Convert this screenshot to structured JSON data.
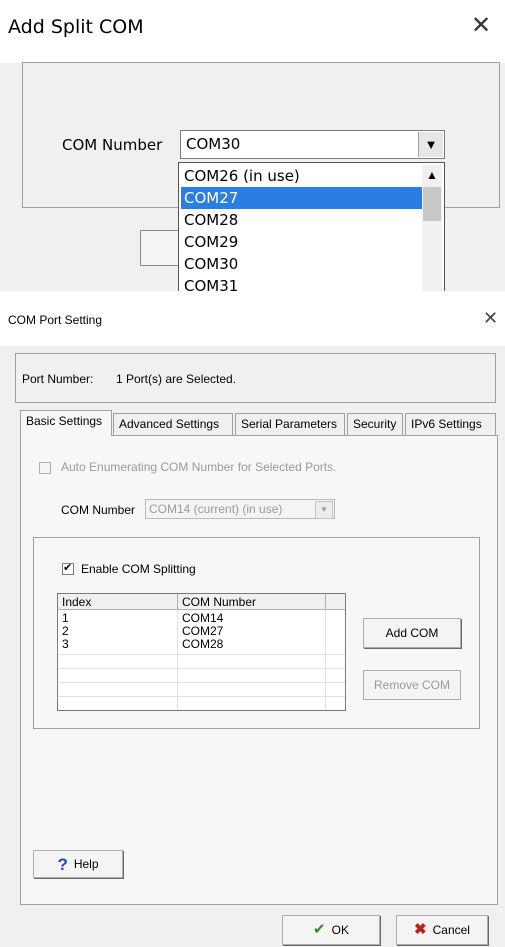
{
  "add_split_dialog": {
    "title": "Add Split COM",
    "close_glyph": "✕",
    "com_label": "COM Number",
    "com_value": "COM30",
    "dropdown_glyph": "▼",
    "options": [
      "COM26 (in use)",
      "COM27",
      "COM28",
      "COM29",
      "COM30",
      "COM31"
    ],
    "selected_option": "COM27",
    "scroll_up_glyph": "▲"
  },
  "com_port_dialog": {
    "title": "COM Port Setting",
    "close_glyph": "✕",
    "port_number_label": "Port Number:",
    "port_number_value": "1 Port(s) are Selected.",
    "tabs": [
      "Basic Settings",
      "Advanced Settings",
      "Serial Parameters",
      "Security",
      "IPv6 Settings"
    ],
    "active_tab": "Basic Settings",
    "auto_enum_label": "Auto Enumerating COM Number for Selected Ports.",
    "auto_enum_checked": false,
    "com_number_label": "COM Number",
    "com_number_value": "COM14 (current) (in use)",
    "enable_split_label": "Enable COM Splitting",
    "enable_split_checked": true,
    "table": {
      "headers": [
        "Index",
        "COM Number"
      ],
      "rows": [
        {
          "index": "1",
          "com": "COM14"
        },
        {
          "index": "2",
          "com": "COM27"
        },
        {
          "index": "3",
          "com": "COM28"
        }
      ]
    },
    "add_com_label": "Add COM",
    "remove_com_label": "Remove COM",
    "help_label": "Help",
    "ok_label": "OK",
    "cancel_label": "Cancel"
  }
}
